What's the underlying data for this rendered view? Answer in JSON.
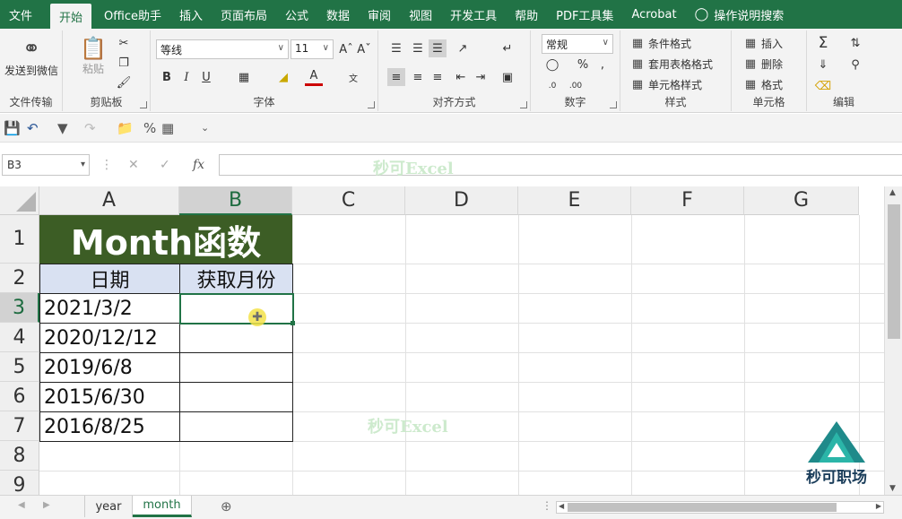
{
  "ribbon_tabs": [
    {
      "label": "文件"
    },
    {
      "label": "开始"
    },
    {
      "label": "Office助手"
    },
    {
      "label": "插入"
    },
    {
      "label": "页面布局"
    },
    {
      "label": "公式"
    },
    {
      "label": "数据"
    },
    {
      "label": "审阅"
    },
    {
      "label": "视图"
    },
    {
      "label": "开发工具"
    },
    {
      "label": "帮助"
    },
    {
      "label": "PDF工具集"
    },
    {
      "label": "Acrobat"
    },
    {
      "label": "操作说明搜索"
    }
  ],
  "ribbon": {
    "wechat": {
      "label": "发送到微信",
      "group": "文件传输"
    },
    "clipboard": {
      "paste": "粘贴",
      "group": "剪贴板"
    },
    "font": {
      "name": "等线",
      "size": "11",
      "bold": "B",
      "italic": "I",
      "underline": "U",
      "group": "字体"
    },
    "align": {
      "group": "对齐方式"
    },
    "number": {
      "format": "常规",
      "group": "数字"
    },
    "styles": {
      "cond": "条件格式",
      "table": "套用表格格式",
      "cell": "单元格样式",
      "group": "样式"
    },
    "cells": {
      "insert": "插入",
      "delete": "删除",
      "format": "格式",
      "group": "单元格"
    },
    "edit": {
      "group": "编辑"
    }
  },
  "formula_bar": {
    "name_box": "B3",
    "fx": "fx",
    "value": ""
  },
  "watermark": "秒可Excel",
  "columns": [
    "A",
    "B",
    "C",
    "D",
    "E",
    "F",
    "G"
  ],
  "rows": [
    "1",
    "2",
    "3",
    "4",
    "5",
    "6",
    "7",
    "8",
    "9"
  ],
  "cells": {
    "title": "Month函数",
    "header_a": "日期",
    "header_b": "获取月份",
    "dates": [
      "2021/3/2",
      "2020/12/12",
      "2019/6/8",
      "2015/6/30",
      "2016/8/25"
    ]
  },
  "logo": {
    "name": "秒可职场"
  },
  "sheet_tabs": [
    {
      "label": "year"
    },
    {
      "label": "month"
    }
  ],
  "accent_color": "#217346",
  "title_fill": "#3c5d25",
  "header_fill": "#d9e1f2"
}
